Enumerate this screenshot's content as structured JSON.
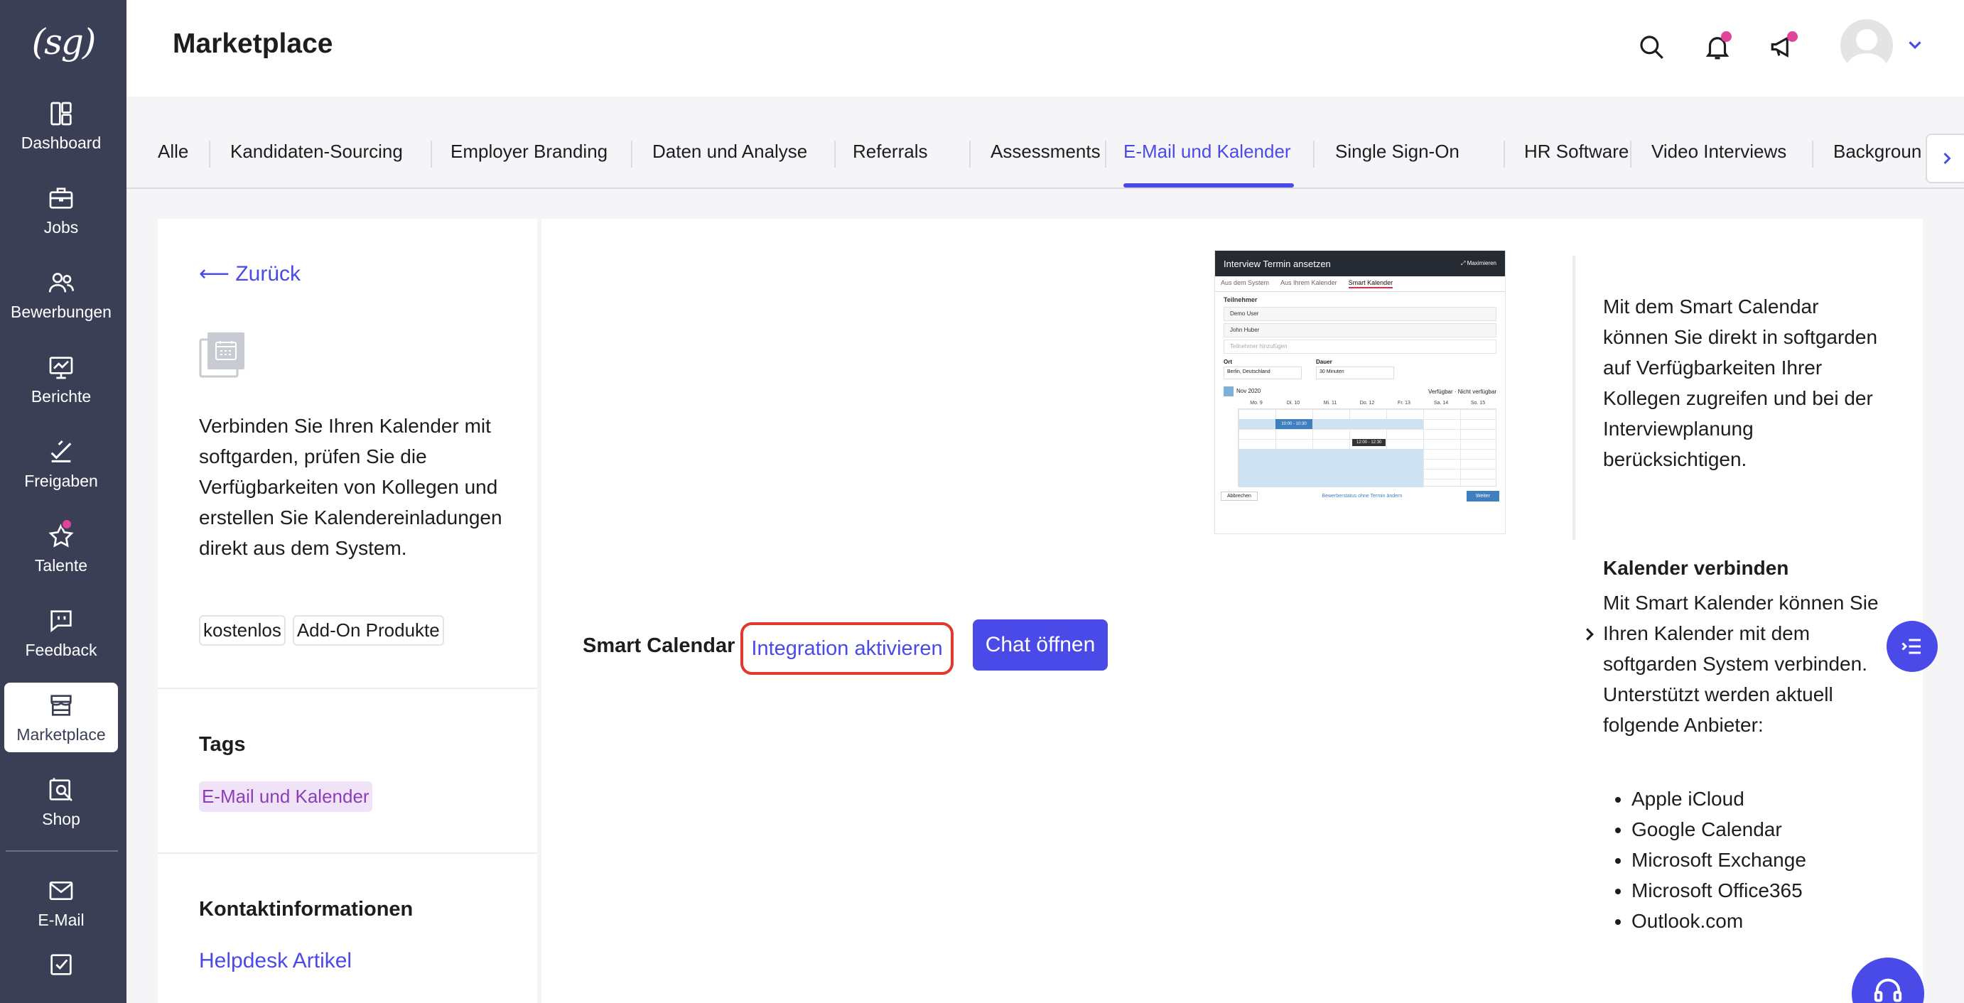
{
  "app": {
    "logo": "(sg)"
  },
  "sidebar": {
    "items": [
      {
        "label": "Dashboard",
        "icon": "dashboard-icon"
      },
      {
        "label": "Jobs",
        "icon": "briefcase-icon"
      },
      {
        "label": "Bewerbungen",
        "icon": "users-icon"
      },
      {
        "label": "Berichte",
        "icon": "chart-icon"
      },
      {
        "label": "Freigaben",
        "icon": "approval-icon"
      },
      {
        "label": "Talente",
        "icon": "star-icon"
      },
      {
        "label": "Feedback",
        "icon": "chat-icon"
      },
      {
        "label": "Marketplace",
        "icon": "store-icon",
        "active": true
      },
      {
        "label": "Shop",
        "icon": "shop-icon"
      },
      {
        "label": "E-Mail",
        "icon": "mail-icon"
      },
      {
        "label": "",
        "icon": "checkbox-icon"
      }
    ]
  },
  "header": {
    "title": "Marketplace",
    "icons": [
      "search-icon",
      "bell-icon",
      "megaphone-icon",
      "avatar",
      "chevron-down-icon"
    ]
  },
  "tabs": [
    "Alle",
    "Kandidaten-Sourcing",
    "Employer Branding",
    "Daten und Analyse",
    "Referrals",
    "Assessments",
    "E-Mail und Kalender",
    "Single Sign-On",
    "HR Software",
    "Video Interviews",
    "Backgroun"
  ],
  "active_tab": "E-Mail und Kalender",
  "left_card": {
    "back": "⟵ Zurück",
    "description": "Verbinden Sie Ihren Kalender mit softgarden, prüfen Sie die Verfügbarkeiten von Kollegen und erstellen Sie Kalendereinladungen direkt aus dem System.",
    "chips": [
      "kostenlos",
      "Add-On Produkte"
    ],
    "tags_title": "Tags",
    "tag": "E-Mail und Kalender",
    "contact_title": "Kontaktinformationen",
    "helpdesk": "Helpdesk Artikel"
  },
  "screenshot": {
    "title": "Interview Termin ansetzen",
    "maximize": "⤢ Maximieren",
    "tabs": [
      "Aus dem System",
      "Aus Ihrem Kalender",
      "Smart Kalender"
    ],
    "section": "Teilnehmer",
    "participants": [
      "Demo User",
      "John Huber"
    ],
    "add_placeholder": "Teilnehmer hinzufügen",
    "ort_label": "Ort",
    "ort_value": "Berlin, Deutschland",
    "dauer_label": "Dauer",
    "dauer_value": "30 Minuten",
    "month": "Nov 2020",
    "legend_available": "Verfügbar",
    "legend_unavailable": "Nicht verfügbar",
    "days": [
      "Mo. 9",
      "Di. 10",
      "Mi. 11",
      "Do. 12",
      "Fr. 13",
      "Sa. 14",
      "So. 15"
    ],
    "slot": "10:00 - 10:30",
    "tooltip": "12:00 - 12:30",
    "cancel": "Abbrechen",
    "footer_note": "Bewerberstatus ohne Termin ändern",
    "next": "Weiter"
  },
  "main": {
    "product_name": "Smart Calendar",
    "integration_link": "Integration aktivieren",
    "chat_button": "Chat öffnen",
    "right_description": "Mit dem Smart Calendar können Sie direkt in softgarden auf Verfügbarkeiten Ihrer Kollegen zugreifen und bei der Interviewplanung berücksichtigen.",
    "connect_title": "Kalender verbinden",
    "connect_text": "Mit Smart Kalender können Sie Ihren Kalender mit dem softgarden System verbinden. Unterstützt werden aktuell folgende Anbieter:",
    "providers": [
      "Apple iCloud",
      "Google Calendar",
      "Microsoft Exchange",
      "Microsoft Office365",
      "Outlook.com"
    ]
  },
  "colors": {
    "sidebar": "#3a3f55",
    "accent": "#4a4ae8",
    "highlight": "#e03a2a",
    "badge": "#e0439a"
  }
}
